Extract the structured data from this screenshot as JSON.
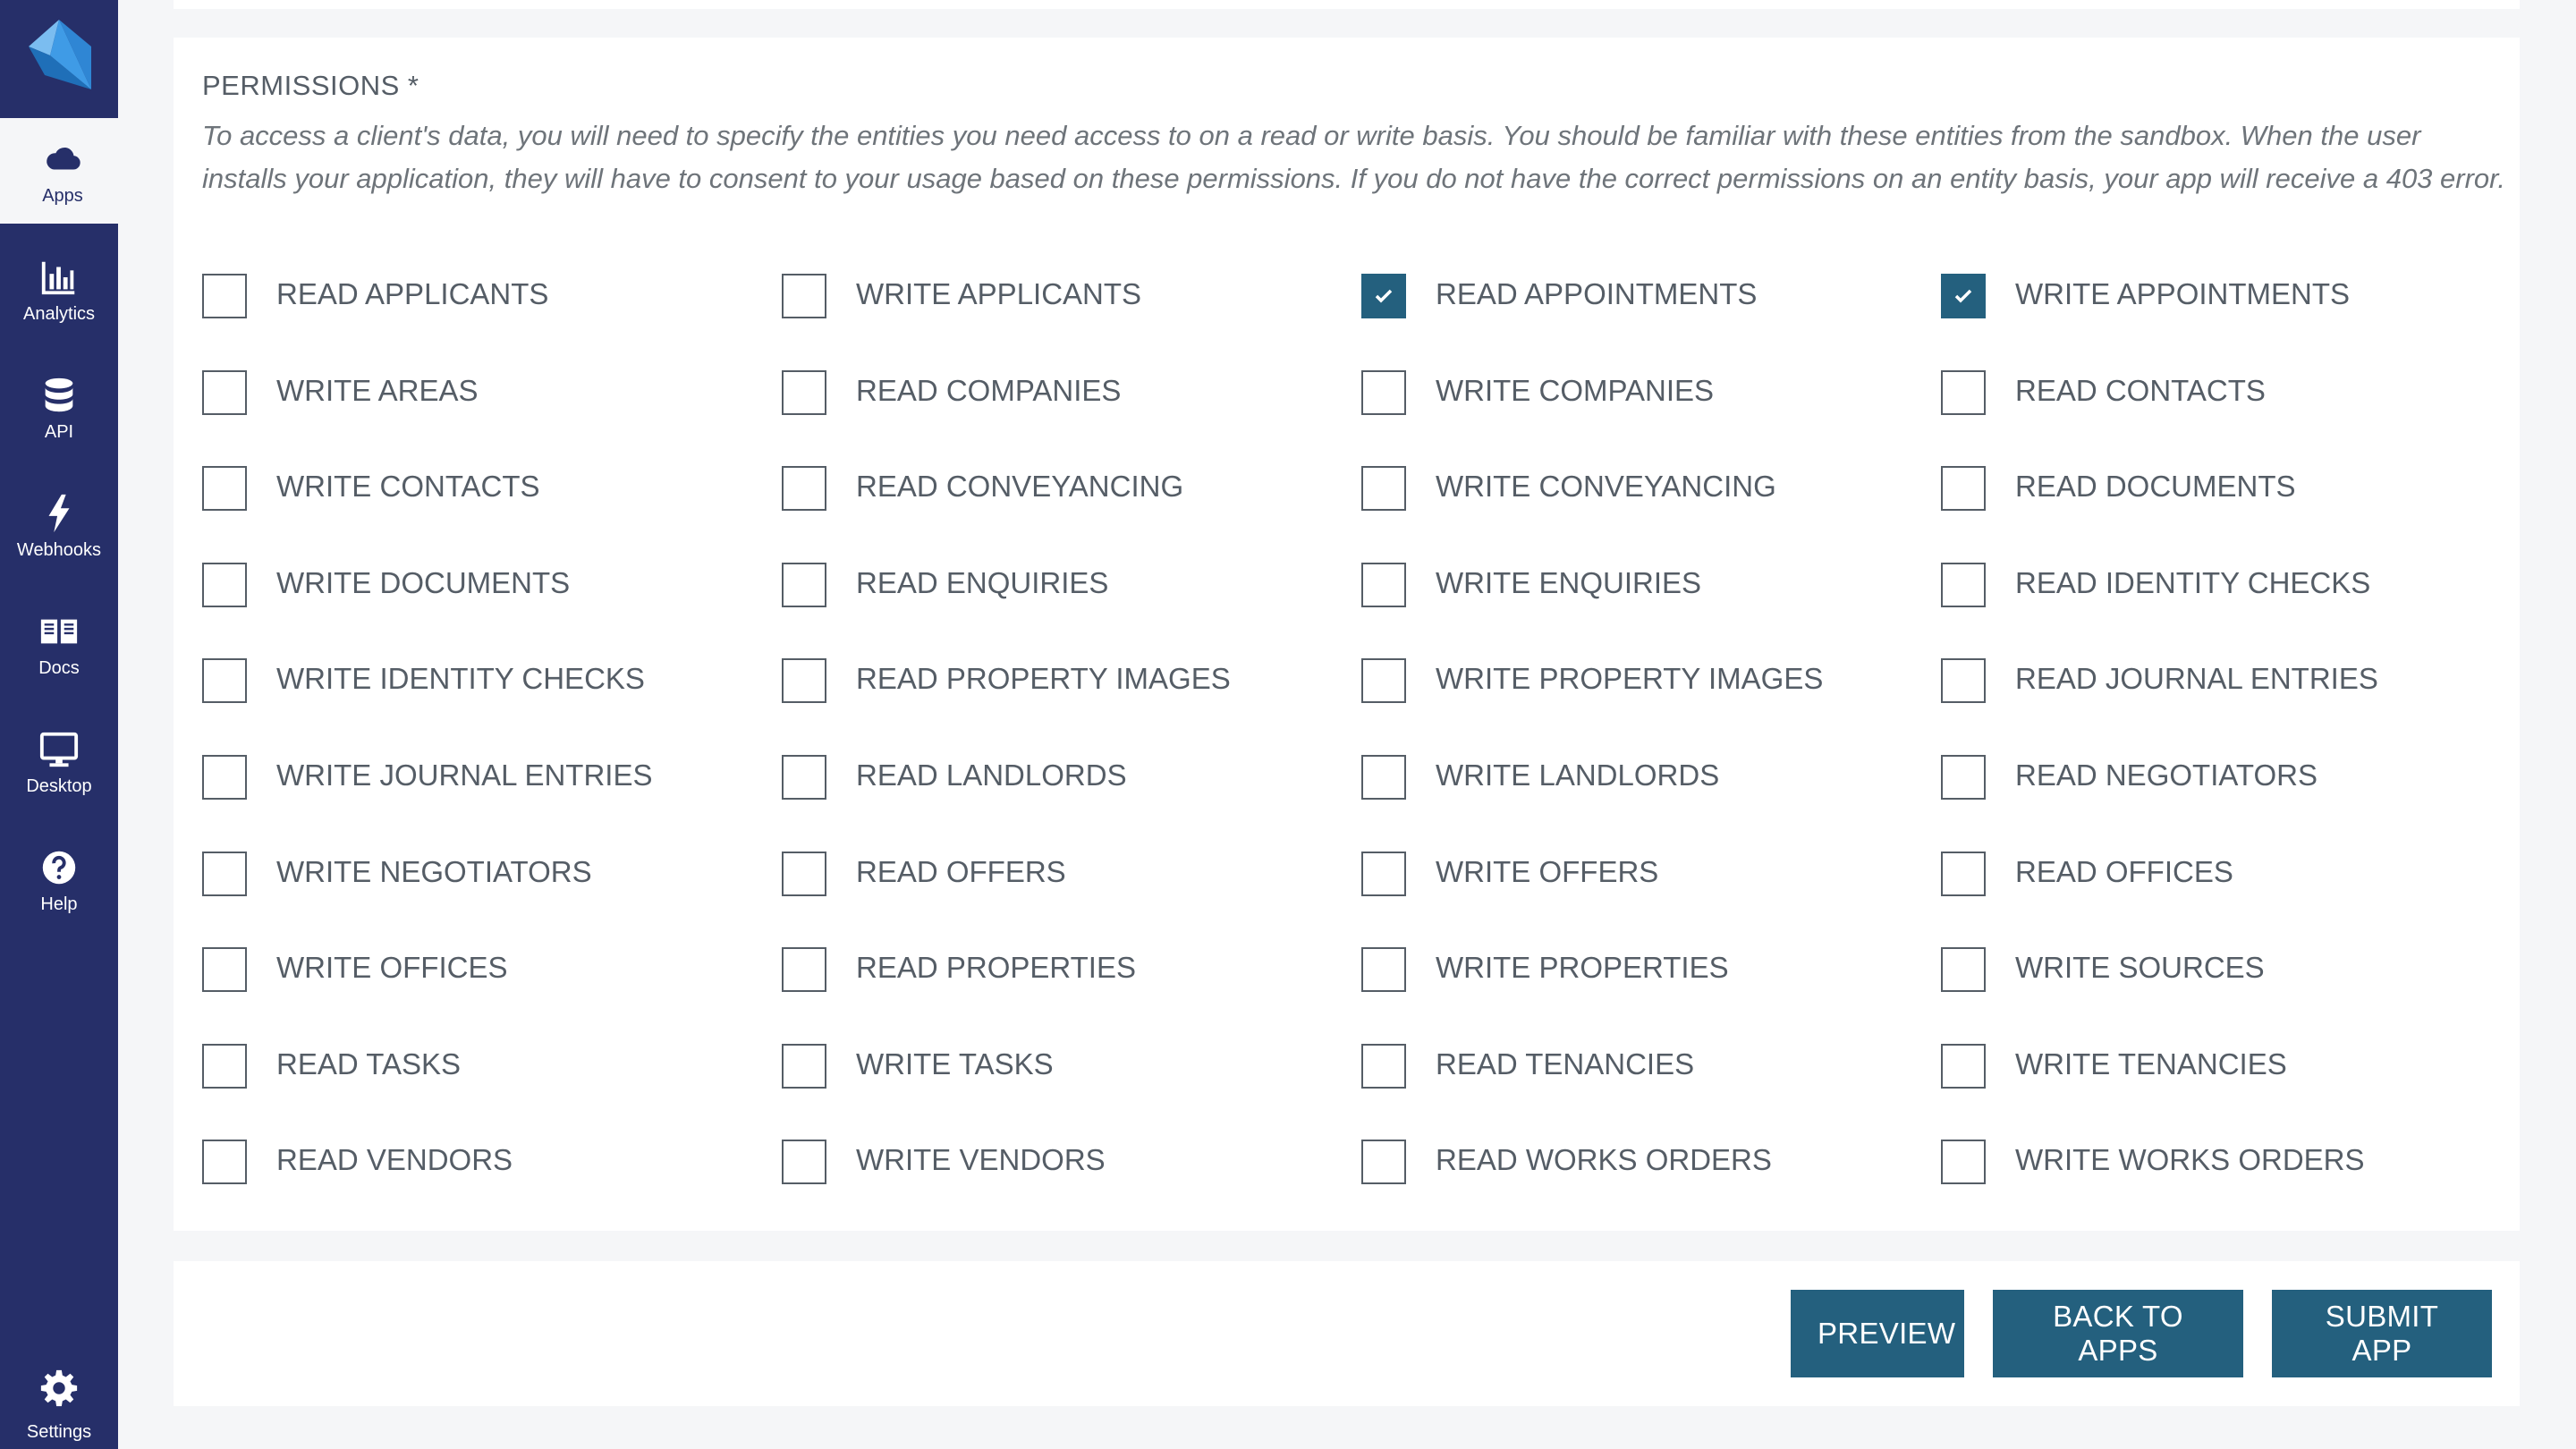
{
  "colors": {
    "sidebar": "#262f69",
    "accent": "#24607e",
    "text": "#555d66",
    "background": "#f5f6f8"
  },
  "sidebar": {
    "items": [
      {
        "label": "Apps",
        "icon": "cloud-icon",
        "active": true
      },
      {
        "label": "Analytics",
        "icon": "bar-chart-icon",
        "active": false
      },
      {
        "label": "API",
        "icon": "database-icon",
        "active": false
      },
      {
        "label": "Webhooks",
        "icon": "bolt-icon",
        "active": false
      },
      {
        "label": "Docs",
        "icon": "book-icon",
        "active": false
      },
      {
        "label": "Desktop",
        "icon": "monitor-icon",
        "active": false
      }
    ],
    "help_label": "Help",
    "settings_label": "Settings"
  },
  "permissions": {
    "title": "PERMISSIONS *",
    "description": "To access a client's data, you will need to specify the entities you need access to on a read or write basis. You should be familiar with these entities from the sandbox. When the user installs your application, they will have to consent to your usage based on these permissions. If you do not have the correct permissions on an entity basis, your app will receive a 403 error.",
    "options": [
      {
        "label": "READ APPLICANTS",
        "checked": false
      },
      {
        "label": "WRITE APPLICANTS",
        "checked": false
      },
      {
        "label": "READ APPOINTMENTS",
        "checked": true
      },
      {
        "label": "WRITE APPOINTMENTS",
        "checked": true
      },
      {
        "label": "WRITE AREAS",
        "checked": false
      },
      {
        "label": "READ COMPANIES",
        "checked": false
      },
      {
        "label": "WRITE COMPANIES",
        "checked": false
      },
      {
        "label": "READ CONTACTS",
        "checked": false
      },
      {
        "label": "WRITE CONTACTS",
        "checked": false
      },
      {
        "label": "READ CONVEYANCING",
        "checked": false
      },
      {
        "label": "WRITE CONVEYANCING",
        "checked": false
      },
      {
        "label": "READ DOCUMENTS",
        "checked": false
      },
      {
        "label": "WRITE DOCUMENTS",
        "checked": false
      },
      {
        "label": "READ ENQUIRIES",
        "checked": false
      },
      {
        "label": "WRITE ENQUIRIES",
        "checked": false
      },
      {
        "label": "READ IDENTITY CHECKS",
        "checked": false
      },
      {
        "label": "WRITE IDENTITY CHECKS",
        "checked": false
      },
      {
        "label": "READ PROPERTY IMAGES",
        "checked": false
      },
      {
        "label": "WRITE PROPERTY IMAGES",
        "checked": false
      },
      {
        "label": "READ JOURNAL ENTRIES",
        "checked": false
      },
      {
        "label": "WRITE JOURNAL ENTRIES",
        "checked": false
      },
      {
        "label": "READ LANDLORDS",
        "checked": false
      },
      {
        "label": "WRITE LANDLORDS",
        "checked": false
      },
      {
        "label": "READ NEGOTIATORS",
        "checked": false
      },
      {
        "label": "WRITE NEGOTIATORS",
        "checked": false
      },
      {
        "label": "READ OFFERS",
        "checked": false
      },
      {
        "label": "WRITE OFFERS",
        "checked": false
      },
      {
        "label": "READ OFFICES",
        "checked": false
      },
      {
        "label": "WRITE OFFICES",
        "checked": false
      },
      {
        "label": "READ PROPERTIES",
        "checked": false
      },
      {
        "label": "WRITE PROPERTIES",
        "checked": false
      },
      {
        "label": "WRITE SOURCES",
        "checked": false
      },
      {
        "label": "READ TASKS",
        "checked": false
      },
      {
        "label": "WRITE TASKS",
        "checked": false
      },
      {
        "label": "READ TENANCIES",
        "checked": false
      },
      {
        "label": "WRITE TENANCIES",
        "checked": false
      },
      {
        "label": "READ VENDORS",
        "checked": false
      },
      {
        "label": "WRITE VENDORS",
        "checked": false
      },
      {
        "label": "READ WORKS ORDERS",
        "checked": false
      },
      {
        "label": "WRITE WORKS ORDERS",
        "checked": false
      }
    ]
  },
  "actions": {
    "preview_label": "PREVIEW",
    "back_label": "BACK TO APPS",
    "submit_label": "SUBMIT APP"
  }
}
